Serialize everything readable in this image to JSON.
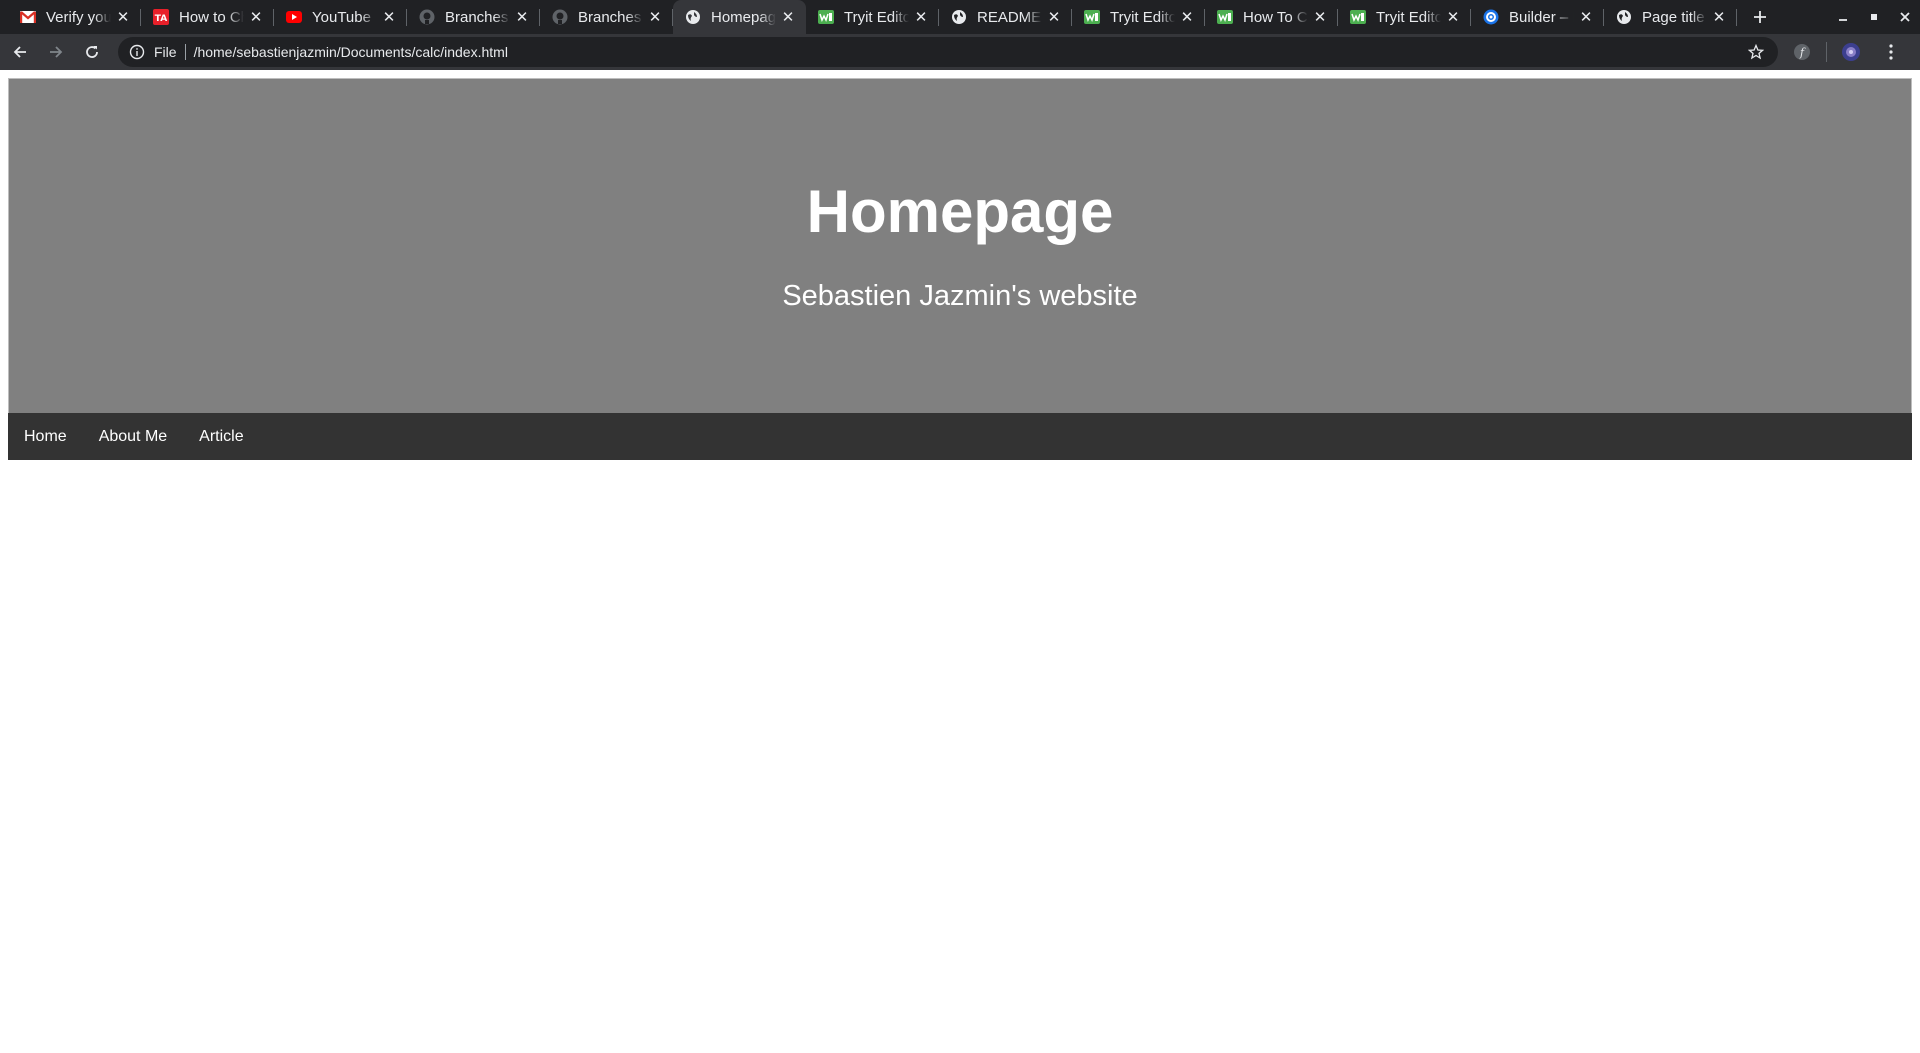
{
  "browser": {
    "tabs": [
      {
        "title": "Verify your",
        "favicon": "gmail-icon",
        "color": "#d93025"
      },
      {
        "title": "How to Ch",
        "favicon": "ta-icon",
        "color": "#e8202a"
      },
      {
        "title": "YouTube",
        "favicon": "youtube-icon",
        "color": "#ff0000"
      },
      {
        "title": "Branches",
        "favicon": "github-icon",
        "color": "#e8eaed"
      },
      {
        "title": "Branches",
        "favicon": "github-icon",
        "color": "#e8eaed"
      },
      {
        "title": "Homepage",
        "favicon": "globe-icon",
        "color": "#e8eaed",
        "active": true
      },
      {
        "title": "Tryit Edito",
        "favicon": "w3schools-icon",
        "color": "#4caf50"
      },
      {
        "title": "README.",
        "favicon": "globe-icon",
        "color": "#e8eaed"
      },
      {
        "title": "Tryit Edito",
        "favicon": "w3schools-icon",
        "color": "#4caf50"
      },
      {
        "title": "How To Cr",
        "favicon": "w3schools-icon",
        "color": "#4caf50"
      },
      {
        "title": "Tryit Edito",
        "favicon": "w3schools-icon",
        "color": "#4caf50"
      },
      {
        "title": "Builder – I",
        "favicon": "gear-icon",
        "color": "#1a73e8"
      },
      {
        "title": "Page title",
        "favicon": "globe-icon",
        "color": "#e8eaed"
      }
    ],
    "omnibox": {
      "scheme": "File",
      "url": "/home/sebastienjazmin/Documents/calc/index.html"
    }
  },
  "page": {
    "hero": {
      "title": "Homepage",
      "subtitle": "Sebastien Jazmin's website"
    },
    "nav": [
      {
        "label": "Home"
      },
      {
        "label": "About Me"
      },
      {
        "label": "Article"
      }
    ]
  },
  "colors": {
    "hero_bg": "#808080",
    "nav_bg": "#333333",
    "chrome_dark": "#202124",
    "chrome_toolbar": "#35363a"
  }
}
